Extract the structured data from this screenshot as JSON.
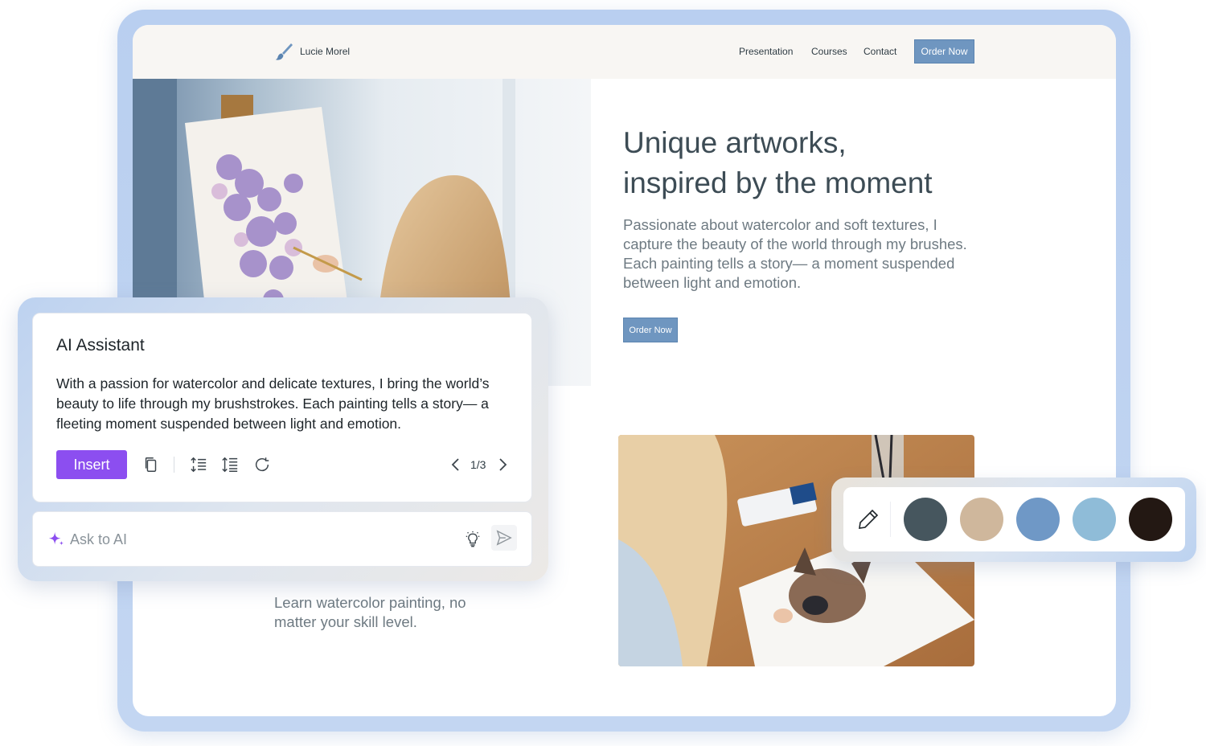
{
  "site": {
    "brand": "Lucie Morel",
    "nav": [
      "Presentation",
      "Courses",
      "Contact"
    ],
    "order_label": "Order Now",
    "hero_title_line1": "Unique artworks,",
    "hero_title_line2": "inspired by the moment",
    "hero_text": "Passionate about watercolor and soft textures, I capture the beauty of the world through my brushes. Each painting tells a story— a moment suspended between light and emotion.",
    "hero_button": "Order Now",
    "learn_text": "Learn watercolor painting, no matter your skill level."
  },
  "ai_panel": {
    "title": "AI Assistant",
    "body": "With a passion for watercolor and delicate textures, I bring the world’s beauty to life through my brushstrokes. Each painting tells a story— a fleeting moment suspended between light and emotion.",
    "insert_label": "Insert",
    "pager": "1/3",
    "ask_placeholder": "Ask to AI",
    "icons": [
      "copy-icon",
      "shorten-icon",
      "expand-icon",
      "regenerate-icon",
      "lightbulb-icon",
      "send-icon",
      "sparkle-icon"
    ]
  },
  "palette": {
    "swatches": [
      "#46565e",
      "#cfb79c",
      "#6f98c6",
      "#8fbcd8",
      "#231813"
    ],
    "tool_icon": "pencil-icon"
  },
  "colors": {
    "frame": "#b9cff0",
    "site_accent": "#6f96c0",
    "insert_purple": "#8c4ef0"
  }
}
